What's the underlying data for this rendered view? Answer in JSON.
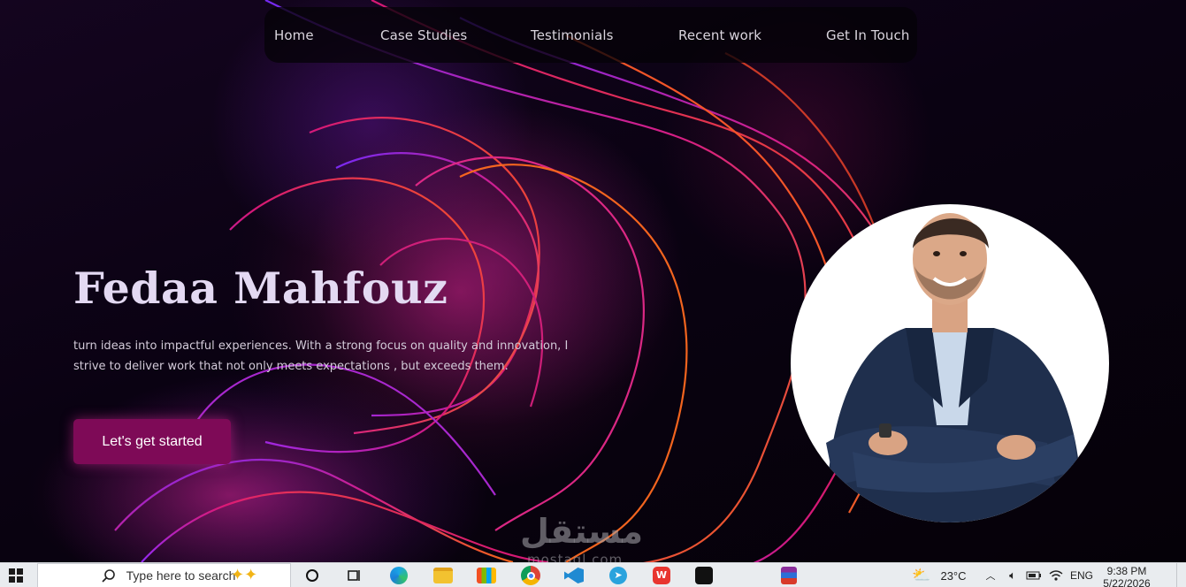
{
  "nav": {
    "items": [
      "Home",
      "Case Studies",
      "Testimonials",
      "Recent work",
      "Get In Touch"
    ]
  },
  "hero": {
    "name": "Fedaa Mahfouz",
    "description": "turn ideas into impactful experiences. With a strong focus on quality and innovation, I strive to deliver work that not only meets expectations , but exceeds them.",
    "cta_label": "Let's get started"
  },
  "watermark": {
    "arabic": "مستقل",
    "latin": "mostaql.com"
  },
  "taskbar": {
    "search_placeholder": "Type here to search",
    "temperature": "23°C",
    "language": "ENG",
    "time": "9:38 PM",
    "date": "5/22/2026",
    "apps": [
      "task-view-icon",
      "edge-icon",
      "file-explorer-icon",
      "store-icon",
      "chrome-icon",
      "vscode-icon",
      "telegram-icon",
      "wps-office-icon",
      "capcut-icon",
      "winrar-icon"
    ]
  },
  "colors": {
    "accent": "#7e0a57",
    "background": "#07020c",
    "nav_text": "#d9d4dd",
    "title": "#e3d9f2"
  }
}
